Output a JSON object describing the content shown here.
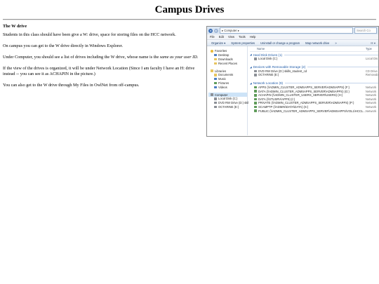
{
  "page": {
    "title": "Campus Drives"
  },
  "article": {
    "heading": "The W drive",
    "p1": "Students in this class should have been give a W: drive, space for storing files on the HCC network.",
    "p2": "On campus you can get to the W drive directly in Windows Explorer.",
    "p3_before": "Under Computer, you should see a list of drives including the W drive, whose name is the ",
    "p3_emph": "same as your user ID",
    "p3_after": ".",
    "p4": "If the view of the drives is organized, it will be under Network Location   (Since I am faculty I have an H: drive instead -- you can see it as ACHAPIN in the picture.)",
    "p5": "You can also get to the W drive through My Files in OwlNet from off-campus."
  },
  "explorer": {
    "address": "▸ Computer ▸",
    "search_placeholder": "Search Co",
    "menu": [
      "File",
      "Edit",
      "View",
      "Tools",
      "Help"
    ],
    "commands": [
      "Organize ▾",
      "System properties",
      "Uninstall or change a program",
      "Map network drive",
      "»"
    ],
    "view_button": "☷ ▾",
    "nav": {
      "favorites": "Favorites",
      "desktop": "Desktop",
      "downloads": "Downloads",
      "recent": "Recent Places",
      "libraries": "Libraries",
      "documents": "Documents",
      "music": "Music",
      "pictures": "Pictures",
      "videos": "Videos",
      "computer": "Computer",
      "local_disk": "Local Disk (C:)",
      "dvd": "DVD RW Drive (D:) skil",
      "octarine": "OCTARINE (E:)"
    },
    "columns": {
      "name": "Name",
      "type": "Type"
    },
    "groups": {
      "hdd": "Hard Disk Drives (1)",
      "removable": "Devices with Removable Storage (2)",
      "network": "Network Location (9)"
    },
    "hdd_rows": [
      {
        "name": "Local Disk (C:)",
        "type": "Local Dis"
      }
    ],
    "removable_rows": [
      {
        "name": "DVD RW Drive (D:) skills_student_cd",
        "type": "CD Drive"
      },
      {
        "name": "OCTARINE (E:)",
        "type": "Removab"
      }
    ],
    "network_rows": [
      {
        "name": "APPS (\\\\ADMIN_CLUSTER_ADMSAPPS_SERVER\\ADMSAPPS) (F:)",
        "type": "Network"
      },
      {
        "name": "DATA (\\\\ADMIN_CLUSTER_ADMSAPPS_SERVER\\ADMSAPPS) (G:)",
        "type": "Network"
      },
      {
        "name": "ACHAPIN (\\\\ADMIN_CLUSTER_USERS_SERVER\\USERS) (H:)",
        "type": "Network"
      },
      {
        "name": "DATA (\\\\STUSRV\\APPS) (I:)",
        "type": "Network"
      },
      {
        "name": "PRIVATE (\\\\ADMIN_CLUSTER_ADMSAPPS_SERVER\\ADMSAPPS) (P:)",
        "type": "Network"
      },
      {
        "name": "SCAMPTP (\\\\ADMIN\\DATA\\DATA) (S:)",
        "type": "Network"
      },
      {
        "name": "PUBLIC (\\\\ADMIN_CLUSTER_ADMSAPPS_SERVER\\ADMSAPPS\\VOL1\\HCCL...",
        "type": "Network"
      }
    ]
  }
}
